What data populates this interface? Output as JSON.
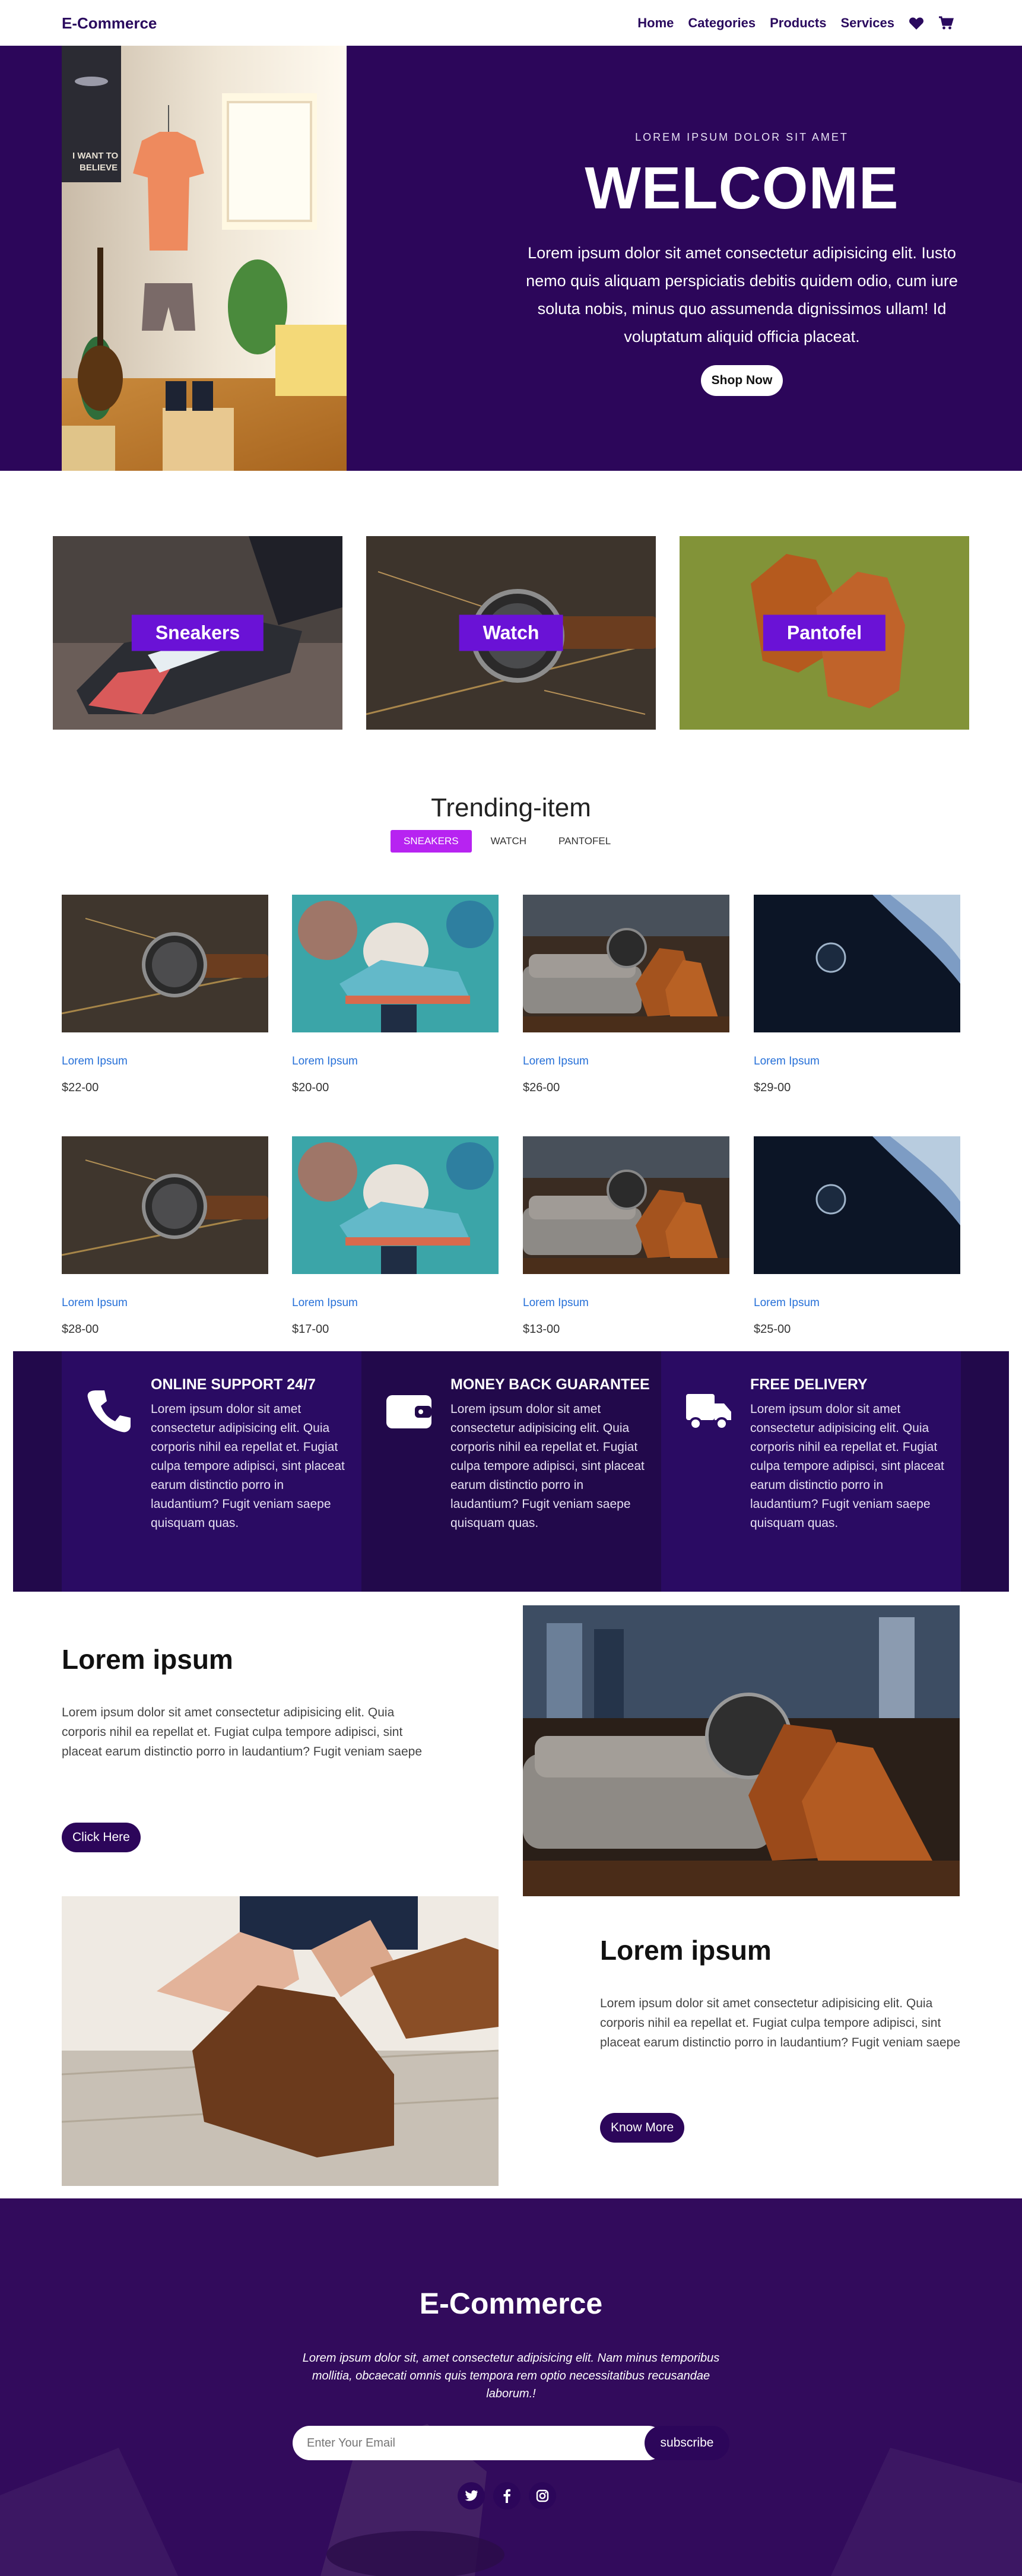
{
  "navbar": {
    "brand": "E-Commerce",
    "links": [
      "Home",
      "Categories",
      "Products",
      "Services"
    ],
    "icons": [
      "heart-icon",
      "cart-icon"
    ]
  },
  "hero": {
    "kicker": "LOREM IPSUM DOLOR SIT AMET",
    "title": "WELCOME",
    "body": "Lorem ipsum dolor sit amet consectetur adipisicing elit. Iusto nemo quis aliquam perspiciatis debitis quidem odio, cum iure soluta nobis, minus quo assumenda dignissimos ullam! Id voluptatum aliquid officia placeat.",
    "button": "Shop Now",
    "poster_text": "I WANT TO BELIEVE"
  },
  "categories": [
    "Sneakers",
    "Watch",
    "Pantofel"
  ],
  "trending": {
    "title": "Trending-item",
    "tabs": [
      "SNEAKERS",
      "WATCH",
      "PANTOFEL"
    ],
    "active_tab": "SNEAKERS",
    "products": [
      {
        "name": "Lorem Ipsum",
        "price": "$22-00"
      },
      {
        "name": "Lorem Ipsum",
        "price": "$20-00"
      },
      {
        "name": "Lorem Ipsum",
        "price": "$26-00"
      },
      {
        "name": "Lorem Ipsum",
        "price": "$29-00"
      },
      {
        "name": "Lorem Ipsum",
        "price": "$28-00"
      },
      {
        "name": "Lorem Ipsum",
        "price": "$17-00"
      },
      {
        "name": "Lorem Ipsum",
        "price": "$13-00"
      },
      {
        "name": "Lorem Ipsum",
        "price": "$25-00"
      }
    ]
  },
  "services": [
    {
      "title": "ONLINE SUPPORT 24/7",
      "icon": "phone-icon",
      "body": "Lorem ipsum dolor sit amet consectetur adipisicing elit. Quia corporis nihil ea repellat et. Fugiat culpa tempore adipisci, sint placeat earum distinctio porro in laudantium? Fugit veniam saepe quisquam quas."
    },
    {
      "title": "MONEY BACK GUARANTEE",
      "icon": "wallet-icon",
      "body": "Lorem ipsum dolor sit amet consectetur adipisicing elit. Quia corporis nihil ea repellat et. Fugiat culpa tempore adipisci, sint placeat earum distinctio porro in laudantium? Fugit veniam saepe quisquam quas."
    },
    {
      "title": "FREE DELIVERY",
      "icon": "truck-icon",
      "body": "Lorem ipsum dolor sit amet consectetur adipisicing elit. Quia corporis nihil ea repellat et. Fugiat culpa tempore adipisci, sint placeat earum distinctio porro in laudantium? Fugit veniam saepe quisquam quas."
    }
  ],
  "features": [
    {
      "title": "Lorem ipsum",
      "body": "Lorem ipsum dolor sit amet consectetur adipisicing elit. Quia corporis nihil ea repellat et. Fugiat culpa tempore adipisci, sint placeat earum distinctio porro in laudantium? Fugit veniam saepe",
      "button": "Click Here"
    },
    {
      "title": "Lorem ipsum",
      "body": "Lorem ipsum dolor sit amet consectetur adipisicing elit. Quia corporis nihil ea repellat et. Fugiat culpa tempore adipisci, sint placeat earum distinctio porro in laudantium? Fugit veniam saepe",
      "button": "Know More"
    }
  ],
  "footer": {
    "title": "E-Commerce",
    "text": "Lorem ipsum dolor sit, amet consectetur adipisicing elit. Nam minus temporibus mollitia, obcaecati omnis quis tempora rem optio necessitatibus recusandae laborum.!",
    "email_placeholder": "Enter Your Email",
    "subscribe": "subscribe",
    "socials": [
      "twitter-icon",
      "facebook-icon",
      "instagram-icon"
    ]
  },
  "colors": {
    "primary_dark": "#2c065a",
    "accent_purple": "#6a12d6",
    "tab_active": "#b723f1",
    "link_blue": "#2670d8"
  }
}
